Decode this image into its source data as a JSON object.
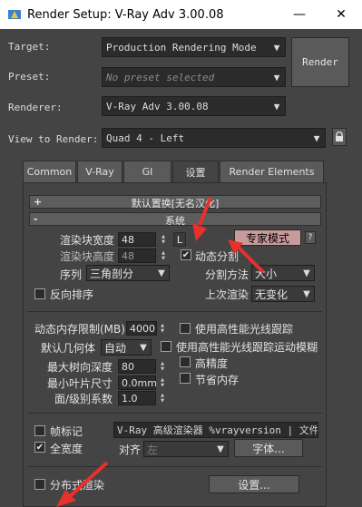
{
  "window": {
    "title": "Render Setup: V-Ray Adv 3.00.08",
    "minimize_glyph": "—",
    "close_glyph": "✕"
  },
  "top": {
    "target_label": "Target:",
    "target_value": "Production Rendering Mode",
    "preset_label": "Preset:",
    "preset_value": "No preset selected",
    "renderer_label": "Renderer:",
    "renderer_value": "V-Ray Adv 3.00.08",
    "view_label": "View to Render:",
    "view_value": "Quad 4 - Left",
    "render_button": "Render"
  },
  "tabs": [
    {
      "label": "Common"
    },
    {
      "label": "V-Ray"
    },
    {
      "label": "GI"
    },
    {
      "label": "设置"
    },
    {
      "label": "Render Elements"
    }
  ],
  "active_tab": "设置",
  "rollouts": {
    "displacement": {
      "sign": "+",
      "title": "默认置换[无名汉化]"
    },
    "system": {
      "sign": "-",
      "title": "系统"
    }
  },
  "system": {
    "bucket_width_label": "渲染块宽度",
    "bucket_width_value": "48",
    "bucket_height_label": "渲染块高度",
    "bucket_height_value": "48",
    "lock_label": "L",
    "expert_mode_button": "专家模式",
    "expert_side_button": "?",
    "dynamic_split_label": "动态分割",
    "dynamic_split_checked": "✔",
    "sequence_label": "序列",
    "sequence_value": "三角剖分",
    "split_method_label": "分割方法",
    "split_method_value": "大小",
    "reverse_label": "反向排序",
    "last_render_label": "上次渲染",
    "last_render_value": "无变化",
    "dyn_mem_label": "动态内存限制(MB)",
    "dyn_mem_value": "4000",
    "high_perf_label": "使用高性能光线跟踪",
    "default_geom_label": "默认几何体",
    "default_geom_value": "自动",
    "high_perf_motion_label": "使用高性能光线跟踪运动模糊",
    "max_tree_label": "最大树向深度",
    "max_tree_value": "80",
    "high_precision_label": "高精度",
    "min_leaf_label": "最小叶片尺寸",
    "min_leaf_value": "0.0mm",
    "save_mem_label": "节省内存",
    "face_level_label": "面/级别系数",
    "face_level_value": "1.0",
    "frame_stamp_label": "帧标记",
    "frame_stamp_text": "V-Ray 高级渲染器 %vrayversion | 文件: %f",
    "full_width_label": "全宽度",
    "full_width_checked": "✔",
    "align_label": "对齐",
    "align_value": "左",
    "font_button": "字体...",
    "distributed_label": "分布式渲染",
    "settings_button": "设置..."
  },
  "colors": {
    "background": "#444444",
    "expert_button": "#c89a9a",
    "annotation_arrow": "#e8302c"
  }
}
